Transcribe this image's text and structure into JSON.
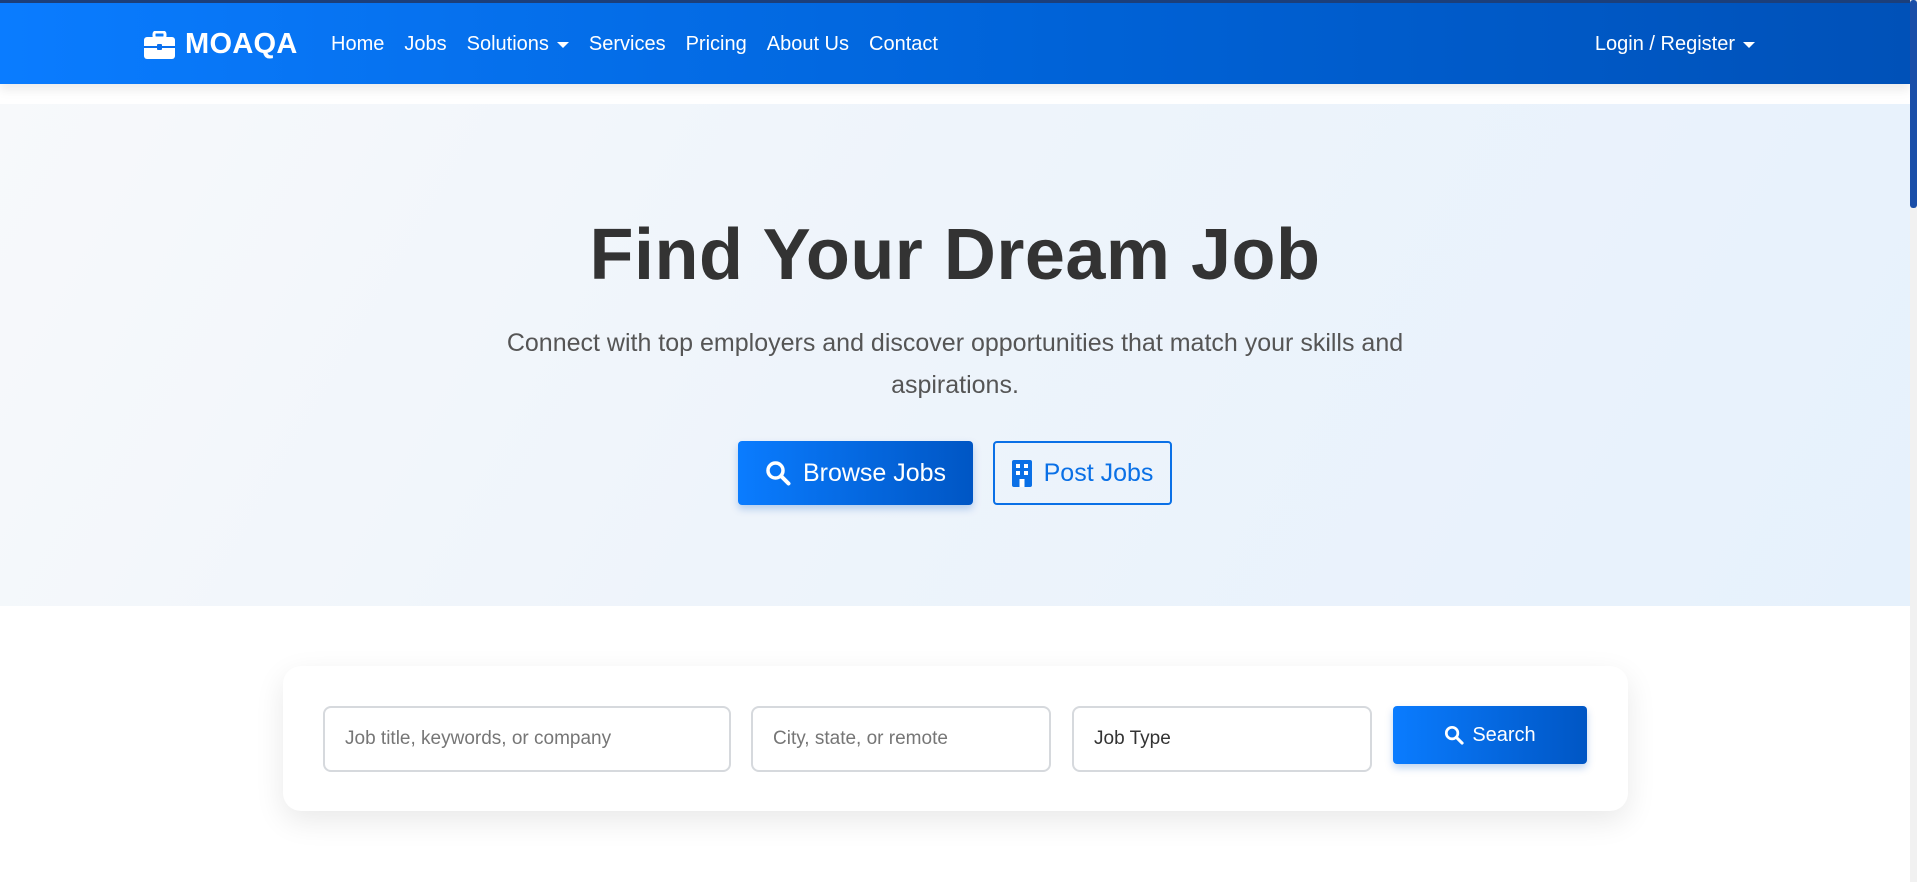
{
  "navbar": {
    "brand": "MOAQA",
    "links": [
      {
        "label": "Home"
      },
      {
        "label": "Jobs"
      },
      {
        "label": "Solutions",
        "dropdown": true
      },
      {
        "label": "Services"
      },
      {
        "label": "Pricing"
      },
      {
        "label": "About Us"
      },
      {
        "label": "Contact"
      }
    ],
    "login_label": "Login / Register"
  },
  "hero": {
    "title": "Find Your Dream Job",
    "subtitle": "Connect with top employers and discover opportunities that match your skills and aspirations.",
    "browse_label": "Browse Jobs",
    "post_label": "Post Jobs"
  },
  "search": {
    "keyword_placeholder": "Job title, keywords, or company",
    "location_placeholder": "City, state, or remote",
    "job_type_value": "Job Type",
    "search_label": "Search"
  },
  "icons": {
    "brand": "briefcase-icon",
    "browse": "search-icon",
    "post": "building-icon",
    "search": "search-icon"
  },
  "colors": {
    "primary": "#0a7cff",
    "primary_dark": "#0056c4",
    "hero_bg": "#eef4fb"
  }
}
